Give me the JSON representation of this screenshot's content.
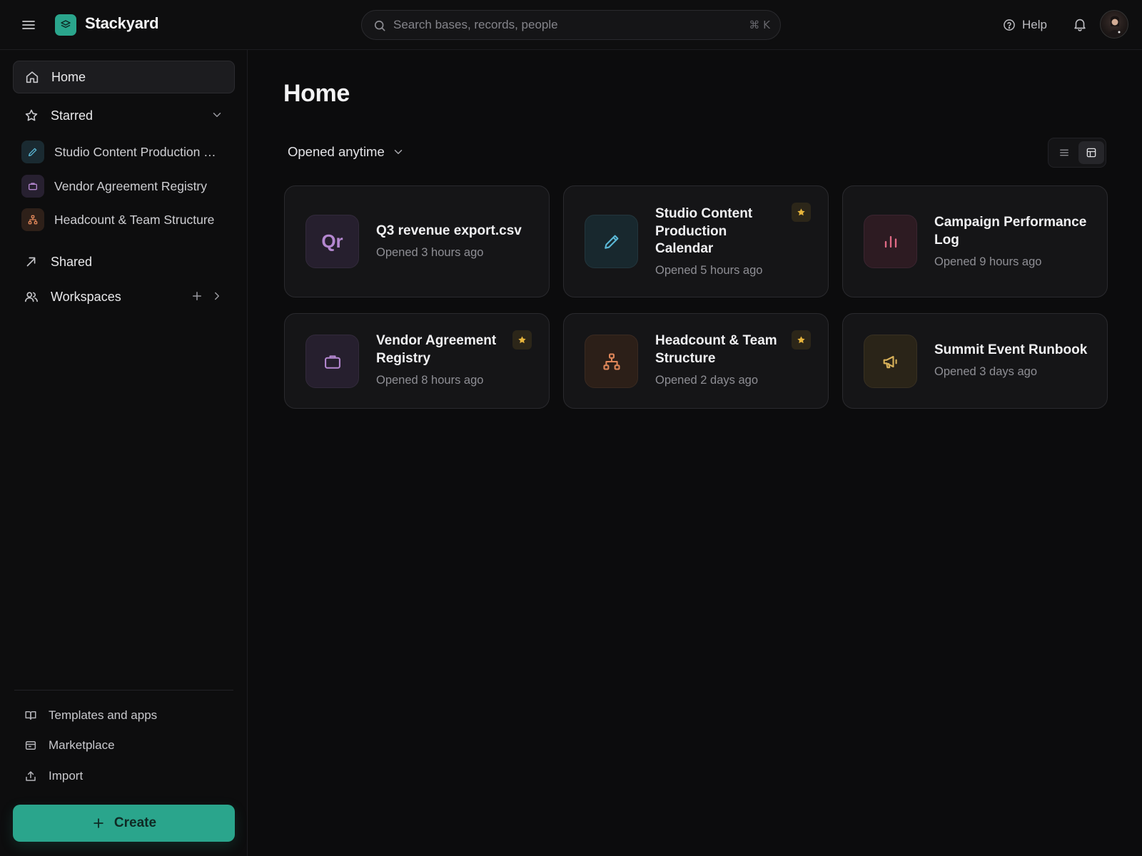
{
  "app": {
    "name": "Stackyard"
  },
  "search": {
    "placeholder": "Search bases, records, people",
    "shortcut": "⌘ K"
  },
  "header": {
    "help_label": "Help"
  },
  "sidebar": {
    "home_label": "Home",
    "starred_label": "Starred",
    "starred_items": [
      {
        "label": "Studio Content Production Calendar",
        "icon": "pencil-icon",
        "color": "#5bb8d6",
        "bg": "#1a2a31"
      },
      {
        "label": "Vendor Agreement Registry",
        "icon": "briefcase-icon",
        "color": "#b487d0",
        "bg": "#272030"
      },
      {
        "label": "Headcount & Team Structure",
        "icon": "org-chart-icon",
        "color": "#e0875a",
        "bg": "#2e2019"
      }
    ],
    "shared_label": "Shared",
    "workspaces_label": "Workspaces",
    "footer": {
      "templates_label": "Templates and apps",
      "marketplace_label": "Marketplace",
      "import_label": "Import"
    },
    "create_label": "Create"
  },
  "main": {
    "title": "Home",
    "filter_label": "Opened anytime",
    "view_mode": "grid",
    "cards": [
      {
        "title": "Q3 revenue export.csv",
        "subtitle": "Opened 3 hours ago",
        "icon": "file-text-tile",
        "tile_text": "Qr",
        "color": "#b487d0",
        "bg": "#261f2e",
        "starred": false
      },
      {
        "title": "Studio Content Production Calendar",
        "subtitle": "Opened 5 hours ago",
        "icon": "pencil-icon",
        "color": "#5bb8d6",
        "bg": "#18282e",
        "starred": true
      },
      {
        "title": "Campaign Performance Log",
        "subtitle": "Opened 9 hours ago",
        "icon": "bar-chart-icon",
        "color": "#e06a86",
        "bg": "#2d1b22",
        "starred": false
      },
      {
        "title": "Vendor Agreement Registry",
        "subtitle": "Opened 8 hours ago",
        "icon": "briefcase-icon",
        "color": "#b487d0",
        "bg": "#261f2e",
        "starred": true
      },
      {
        "title": "Headcount & Team Structure",
        "subtitle": "Opened 2 days ago",
        "icon": "org-chart-icon",
        "color": "#e0875a",
        "bg": "#2c1f18",
        "starred": true
      },
      {
        "title": "Summit Event Runbook",
        "subtitle": "Opened 3 days ago",
        "icon": "megaphone-icon",
        "color": "#d9b25a",
        "bg": "#2a2418",
        "starred": false
      }
    ]
  },
  "colors": {
    "accent": "#2aa58c",
    "star": "#e8b53c"
  }
}
